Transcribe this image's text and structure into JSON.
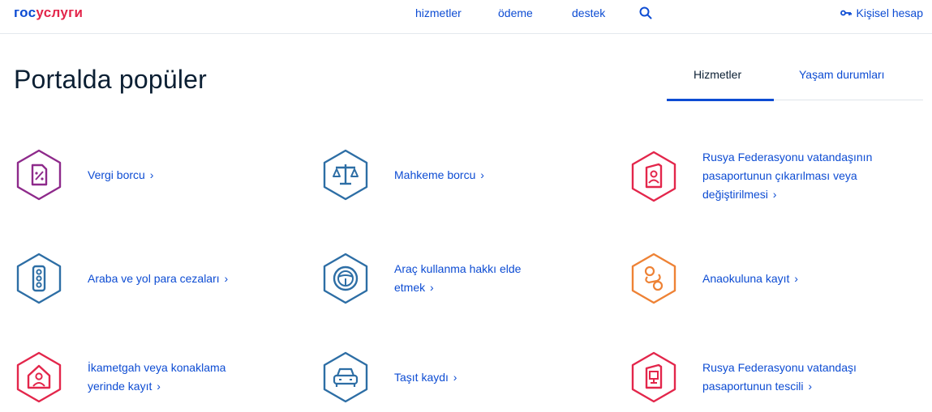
{
  "header": {
    "logo_part1": "гос",
    "logo_part2": "услуги",
    "nav": [
      "hizmetler",
      "ödeme",
      "destek"
    ],
    "account_label": "Kişisel hesap"
  },
  "page_title": "Portalda popüler",
  "tabs": [
    {
      "label": "Hizmetler",
      "active": true
    },
    {
      "label": "Yaşam durumları",
      "active": false
    }
  ],
  "colors": {
    "accent": "#0d4cd3",
    "purple": "#8e2a8b",
    "blue": "#2d6ea5",
    "red": "#e3264b",
    "orange": "#ee8235"
  },
  "services": [
    {
      "label": "Vergi borcu",
      "icon": "tax-document-icon",
      "color": "purple"
    },
    {
      "label": "Mahkeme borcu",
      "icon": "scales-icon",
      "color": "blue"
    },
    {
      "label": "Rusya Federasyonu vatandaşının pasaportunun çıkarılması veya değiştirilmesi",
      "icon": "passport-icon",
      "color": "red"
    },
    {
      "label": "Araba ve yol para cezaları",
      "icon": "traffic-light-icon",
      "color": "blue"
    },
    {
      "label": "Araç kullanma hakkı elde etmek",
      "icon": "steering-wheel-icon",
      "color": "blue"
    },
    {
      "label": "Anaokuluna kayıt",
      "icon": "pacifier-icon",
      "color": "orange"
    },
    {
      "label": "İkametgah veya konaklama yerinde kayıt",
      "icon": "house-person-icon",
      "color": "red"
    },
    {
      "label": "Taşıt kaydı",
      "icon": "car-icon",
      "color": "blue"
    },
    {
      "label": "Rusya Federasyonu vatandaşı pasaportunun tescili",
      "icon": "passport-stamp-icon",
      "color": "red"
    }
  ]
}
